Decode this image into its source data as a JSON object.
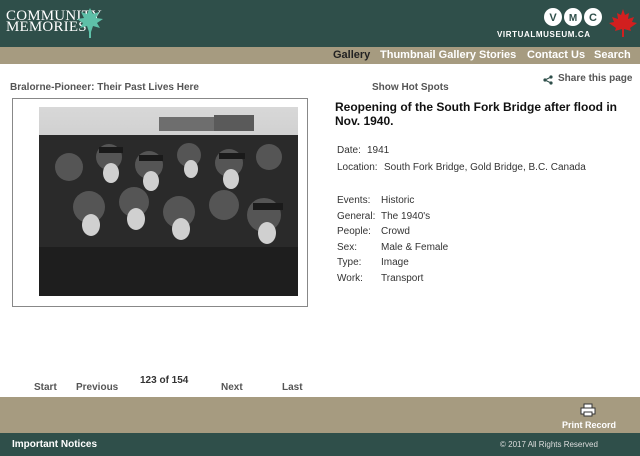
{
  "header": {
    "logo_line1": "COMMUNITY",
    "logo_line2": "MEMORIES",
    "logo_icon": "leaf-tree-icon",
    "vmc_label": "VIRTUALMUSEUM.CA",
    "maple_icon": "maple-leaf-icon"
  },
  "nav": {
    "items": [
      "Gallery",
      "Thumbnail Gallery",
      "Stories",
      "Contact Us",
      "Search"
    ],
    "active": "Gallery"
  },
  "breadcrumb": "Bralorne-Pioneer: Their Past Lives Here",
  "hot_spots": "Show Hot Spots",
  "share": {
    "label": "Share this page",
    "icon": "share-icon"
  },
  "record": {
    "title": "Reopening of the South Fork Bridge after flood in Nov. 1940.",
    "date_label": "Date:",
    "date": "1941",
    "location_label": "Location:",
    "location": "South Fork Bridge, Gold Bridge, B.C. Canada",
    "events_label": "Events:",
    "events": "Historic",
    "general_label": "General:",
    "general": "The 1940's",
    "people_label": "People:",
    "people": "Crowd",
    "sex_label": "Sex:",
    "sex": "Male & Female",
    "type_label": "Type:",
    "type": "Image",
    "work_label": "Work:",
    "work": "Transport"
  },
  "pager": {
    "start": "Start",
    "previous": "Previous",
    "position": "123 of 154",
    "next": "Next",
    "last": "Last"
  },
  "print": {
    "label": "Print Record",
    "icon": "printer-icon"
  },
  "footer": {
    "notices": "Important Notices",
    "copyright": "© 2017 All Rights Reserved"
  },
  "colors": {
    "header_bg": "#2f4f4a",
    "nav_bg": "#a69b80",
    "maple": "#d21f1f"
  }
}
